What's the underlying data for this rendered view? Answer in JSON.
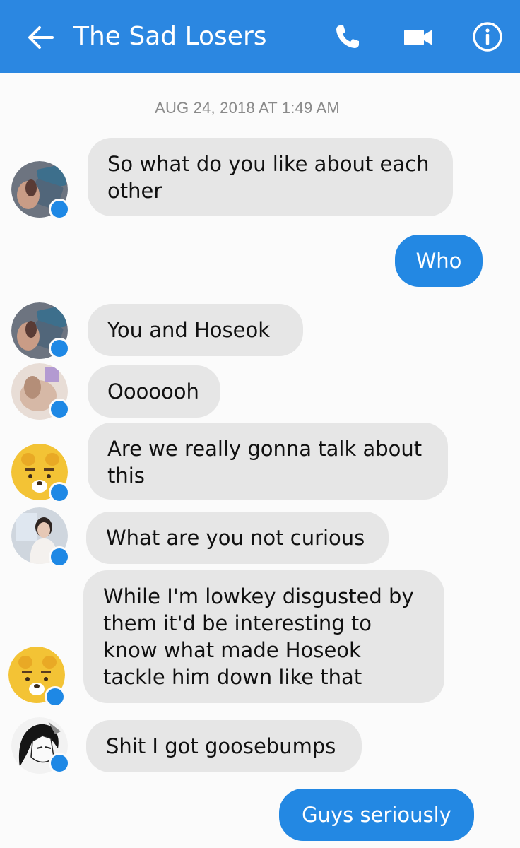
{
  "header": {
    "title": "The Sad Losers",
    "back_icon": "arrow-left-icon",
    "call_icon": "phone-icon",
    "video_icon": "video-camera-icon",
    "info_icon": "info-icon",
    "color": "#2b87e1"
  },
  "timestamp": "AUG 24, 2018 AT 1:49 AM",
  "messages": [
    {
      "direction": "incoming",
      "text": "So what do you like about each other"
    },
    {
      "direction": "outgoing",
      "text": "Who"
    },
    {
      "direction": "incoming",
      "text": "You and Hoseok"
    },
    {
      "direction": "incoming",
      "text": "Ooooooh"
    },
    {
      "direction": "incoming",
      "text": "Are we really gonna talk about this"
    },
    {
      "direction": "incoming",
      "text": "What are you not curious"
    },
    {
      "direction": "incoming",
      "text": "While I'm lowkey disgusted by them it'd be interesting to know what made Hoseok tackle him down like that"
    },
    {
      "direction": "incoming",
      "text": "Shit I got goosebumps"
    },
    {
      "direction": "outgoing",
      "text": "Guys seriously"
    }
  ],
  "colors": {
    "incoming_bubble": "#e6e6e6",
    "outgoing_bubble": "#2388e3",
    "messenger_badge": "#1e88e5"
  }
}
